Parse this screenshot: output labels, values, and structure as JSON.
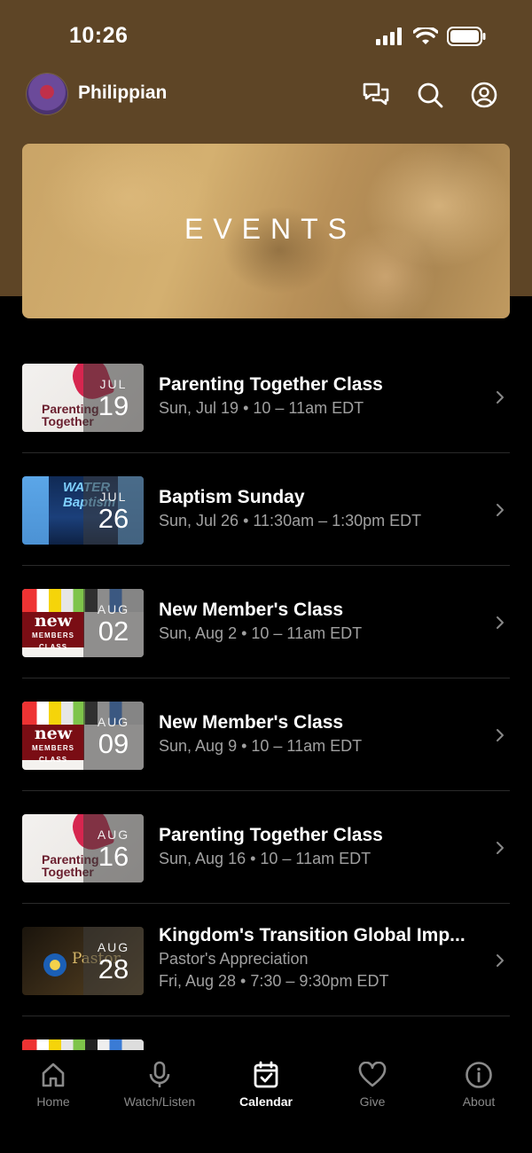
{
  "status_bar": {
    "time": "10:26"
  },
  "header": {
    "church_name": "Philippian"
  },
  "banner": {
    "title": "EVENTS"
  },
  "events": [
    {
      "title": "Parenting Together Class",
      "subtitle": "Sun, Jul 19 • 10 – 11am EDT",
      "subtitle2": "",
      "month": "JUL",
      "day": "19",
      "thumb_text": "Parenting Together"
    },
    {
      "title": "Baptism Sunday",
      "subtitle": "Sun, Jul 26 • 11:30am – 1:30pm EDT",
      "subtitle2": "",
      "month": "JUL",
      "day": "26",
      "thumb_text": "WATER Baptism"
    },
    {
      "title": "New Member's Class",
      "subtitle": "Sun, Aug 2 • 10 – 11am EDT",
      "subtitle2": "",
      "month": "AUG",
      "day": "02",
      "thumb_text": "new",
      "thumb_text2": "MEMBERS CLASS"
    },
    {
      "title": "New Member's Class",
      "subtitle": "Sun, Aug 9 • 10 – 11am EDT",
      "subtitle2": "",
      "month": "AUG",
      "day": "09",
      "thumb_text": "new",
      "thumb_text2": "MEMBERS CLASS"
    },
    {
      "title": "Parenting Together Class",
      "subtitle": "Sun, Aug 16 • 10 – 11am EDT",
      "subtitle2": "",
      "month": "AUG",
      "day": "16",
      "thumb_text": "Parenting Together"
    },
    {
      "title": "Kingdom's Transition Global Imp...",
      "subtitle": "Pastor's Appreciation",
      "subtitle2": "Fri, Aug 28 • 7:30 – 9:30pm EDT",
      "month": "AUG",
      "day": "28",
      "thumb_text": "Pastor"
    }
  ],
  "tabs": [
    {
      "label": "Home",
      "icon": "home-icon",
      "active": false
    },
    {
      "label": "Watch/Listen",
      "icon": "microphone-icon",
      "active": false
    },
    {
      "label": "Calendar",
      "icon": "calendar-icon",
      "active": true
    },
    {
      "label": "Give",
      "icon": "heart-icon",
      "active": false
    },
    {
      "label": "About",
      "icon": "info-icon",
      "active": false
    }
  ],
  "colors": {
    "header_brown": "#5e4526",
    "accent_red": "#d6264f",
    "muted_text": "#a0a0a0"
  }
}
